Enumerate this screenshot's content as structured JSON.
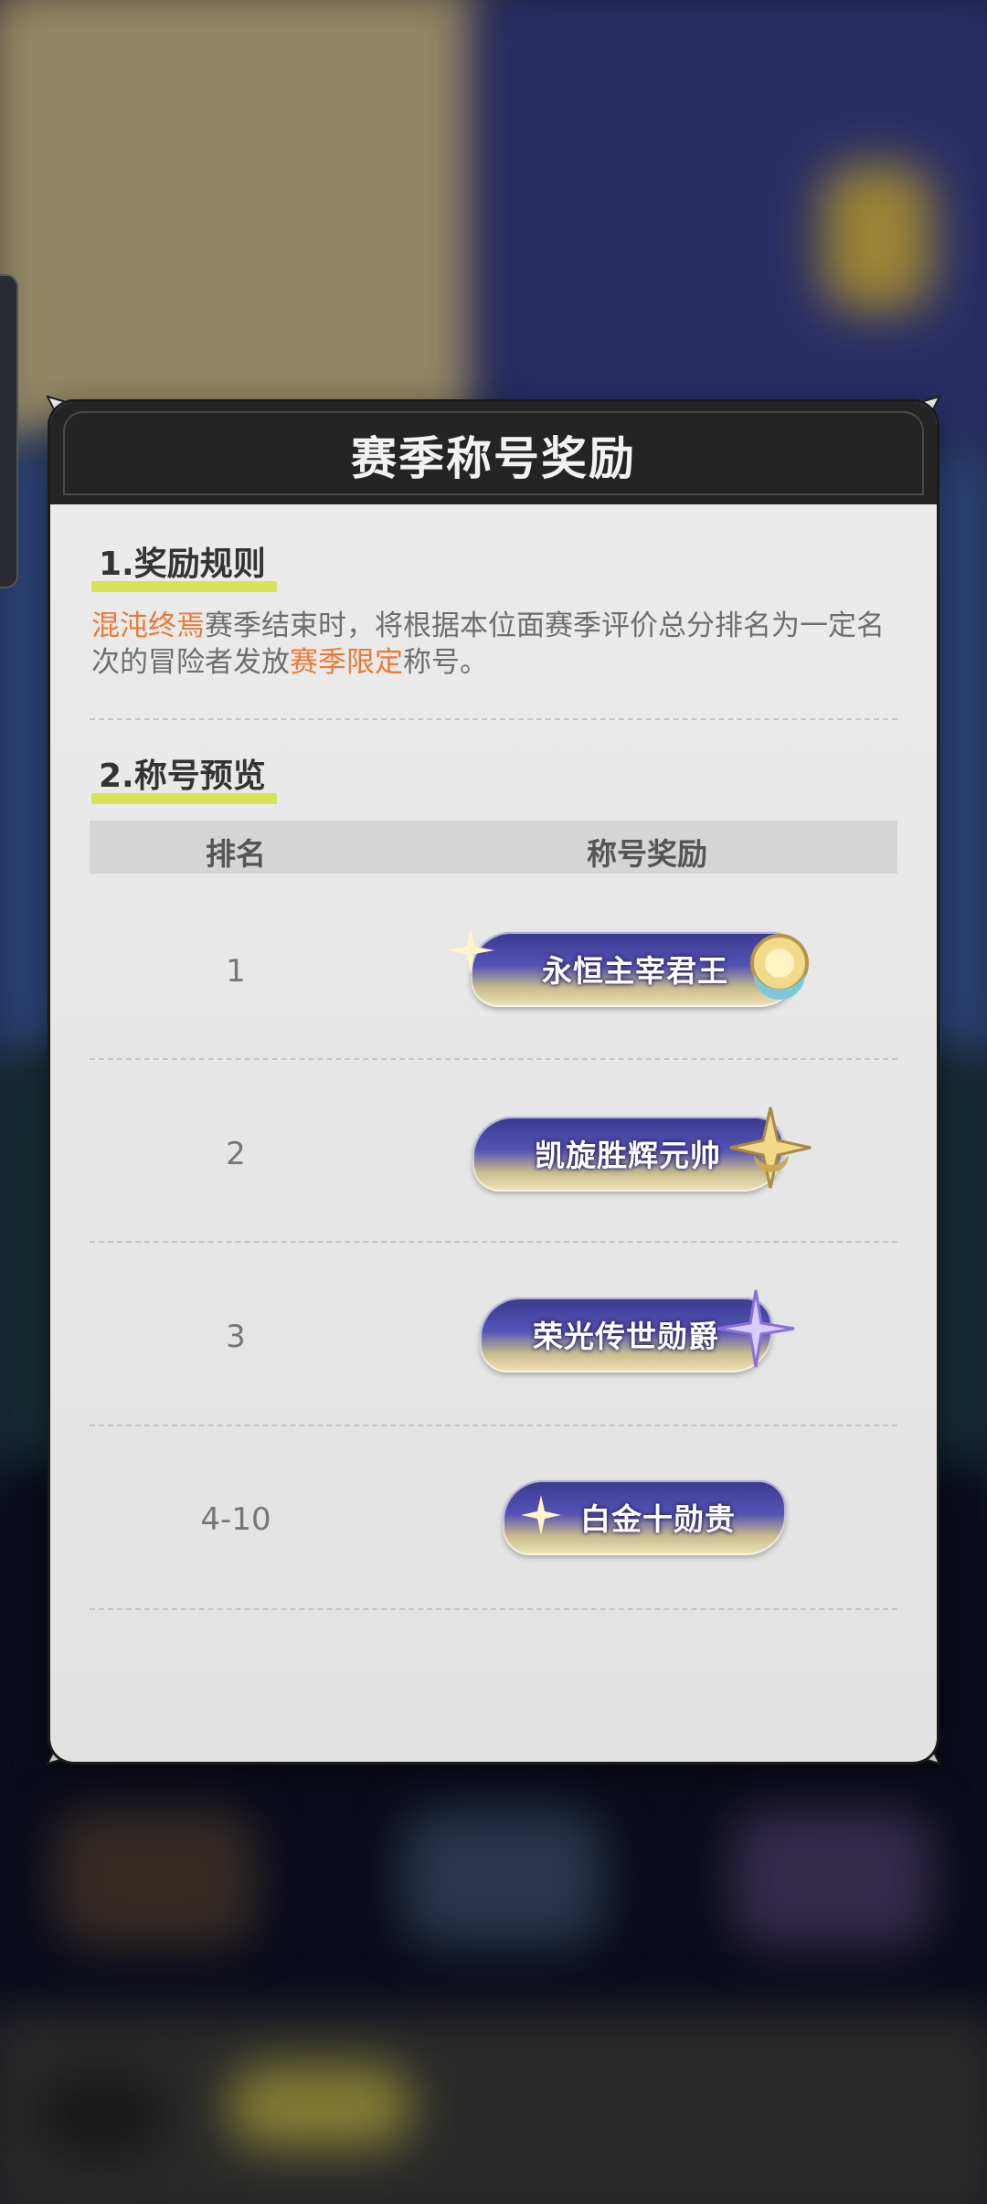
{
  "modal": {
    "title": "赛季称号奖励",
    "section1": {
      "heading": "1.奖励规则",
      "rule_prefix_highlight": "混沌终焉",
      "rule_mid": "赛季结束时，将根据本位面赛季评价总分排名为一定名次的冒险者发放",
      "rule_highlight2": "赛季限定",
      "rule_suffix": "称号。"
    },
    "section2": {
      "heading": "2.称号预览",
      "columns": [
        "排名",
        "称号奖励"
      ],
      "rows": [
        {
          "rank": "1",
          "title": "永恒主宰君王",
          "emblem": "sun-moon-icon"
        },
        {
          "rank": "2",
          "title": "凯旋胜辉元帅",
          "emblem": "star-moon-icon"
        },
        {
          "rank": "3",
          "title": "荣光传世勋爵",
          "emblem": "sparkle-star-icon"
        },
        {
          "rank": "4-10",
          "title": "白金十勋贵",
          "emblem": "small-sparkle-icon"
        }
      ]
    }
  },
  "colors": {
    "accent_orange": "#ea7a37",
    "highlight_yellow": "#d8e256",
    "header_dark": "#242424"
  }
}
